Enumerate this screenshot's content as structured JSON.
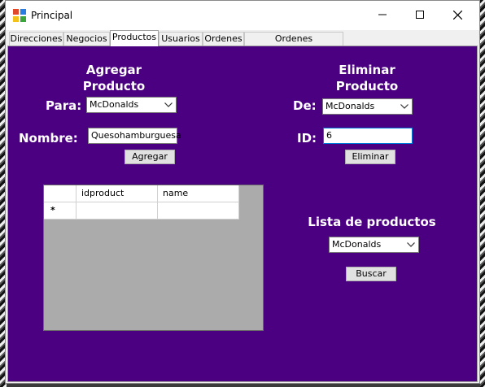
{
  "window": {
    "title": "Principal"
  },
  "tabs": [
    {
      "label": "Direcciones"
    },
    {
      "label": "Negocios"
    },
    {
      "label": "Productos"
    },
    {
      "label": "Usuarios"
    },
    {
      "label": "Ordenes"
    },
    {
      "label": "Ordenes (Administrador)"
    }
  ],
  "agregar": {
    "heading_line1": "Agregar",
    "heading_line2": "Producto",
    "para_label": "Para:",
    "para_value": "McDonalds",
    "nombre_label": "Nombre:",
    "nombre_value": "Quesohamburguesa",
    "button": "Agregar"
  },
  "eliminar": {
    "heading_line1": "Eliminar",
    "heading_line2": "Producto",
    "de_label": "De:",
    "de_value": "McDonalds",
    "id_label": "ID:",
    "id_value": "6",
    "button": "Eliminar"
  },
  "grid": {
    "columns": [
      "idproduct",
      "name"
    ],
    "new_row_marker": "*"
  },
  "lista": {
    "heading": "Lista de productos",
    "selected": "McDonalds",
    "button": "Buscar"
  },
  "colors": {
    "panel": "#4b0082",
    "accent": "#0078d7"
  },
  "icons": [
    "app-icon",
    "minimize-icon",
    "maximize-icon",
    "close-icon",
    "chevron-down-icon"
  ]
}
